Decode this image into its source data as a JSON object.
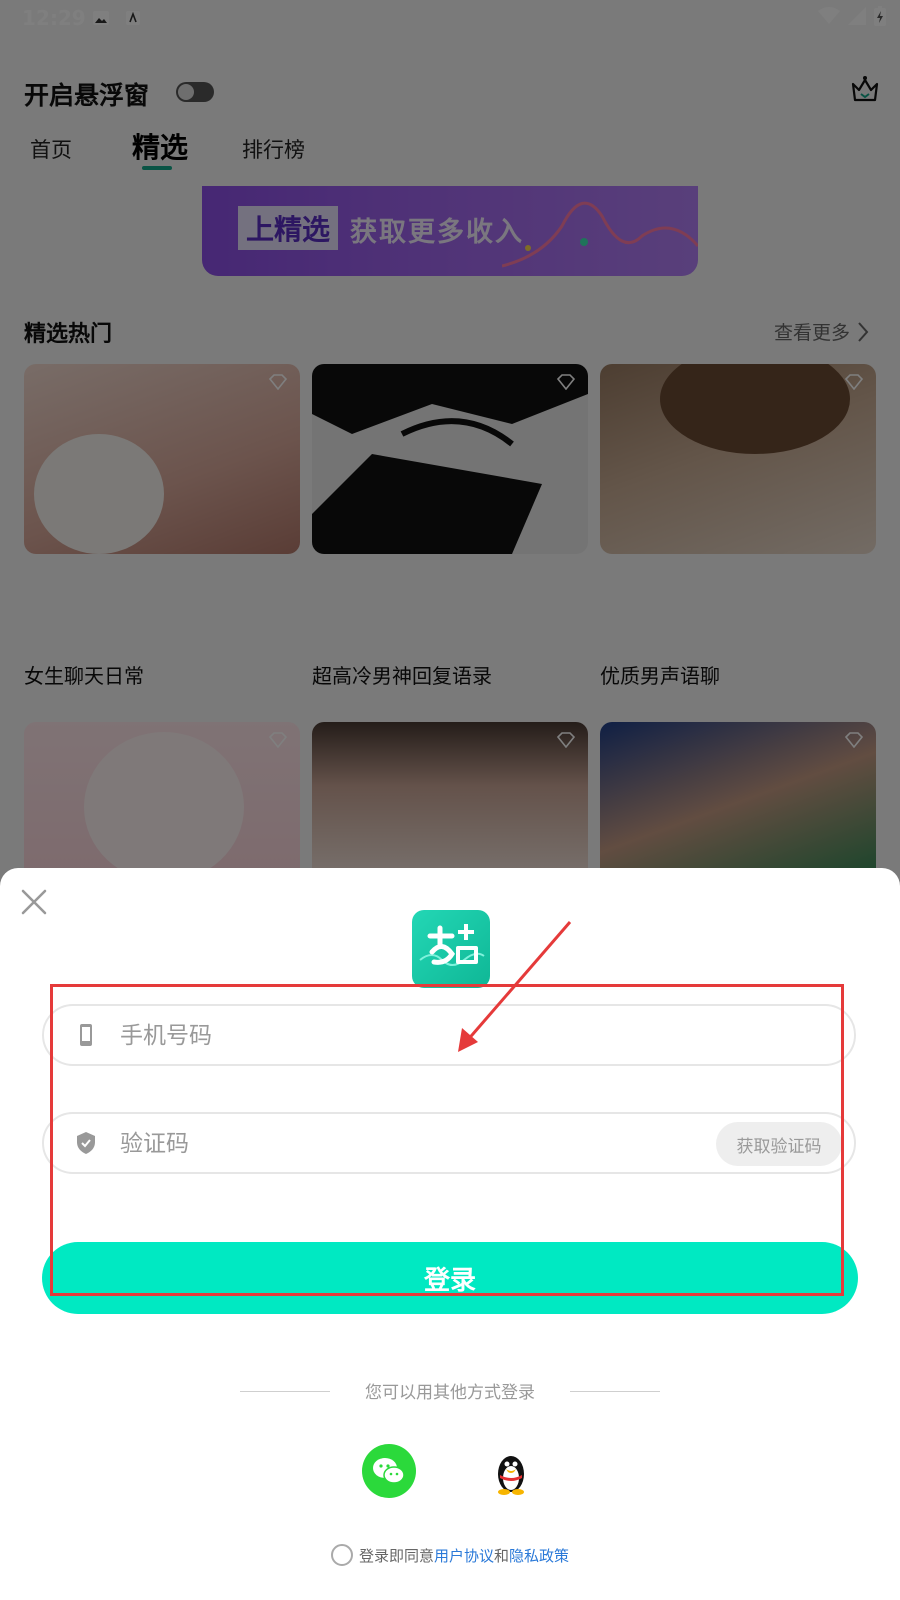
{
  "status_bar": {
    "time": "12:29"
  },
  "header": {
    "title": "开启悬浮窗"
  },
  "tabs": [
    {
      "label": "首页"
    },
    {
      "label": "精选"
    },
    {
      "label": "排行榜"
    }
  ],
  "banner": {
    "tag": "上精选",
    "text": "获取更多收入"
  },
  "section": {
    "title": "精选热门",
    "more": "查看更多"
  },
  "cards": [
    {
      "caption": "女生聊天日常"
    },
    {
      "caption": "超高冷男神回复语录"
    },
    {
      "caption": "优质男声语聊"
    }
  ],
  "login": {
    "phone_placeholder": "手机号码",
    "code_placeholder": "验证码",
    "get_code": "获取验证码",
    "submit": "登录",
    "other_methods": "您可以用其他方式登录",
    "agree_prefix": "登录即同意",
    "user_agreement": "用户协议",
    "and": "和",
    "privacy_policy": "隐私政策"
  },
  "colors": {
    "accent": "#00e9c2",
    "link": "#2a79d8",
    "annotation": "#e53a3a"
  }
}
